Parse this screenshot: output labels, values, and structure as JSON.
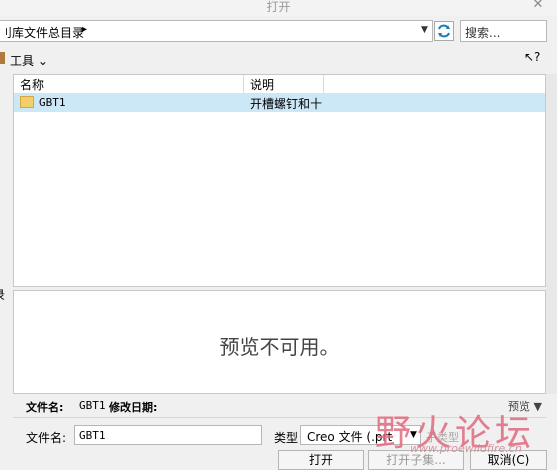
{
  "window": {
    "title": "打开",
    "close_glyph": "✕"
  },
  "address": {
    "path": "刂库文件总目录",
    "chevron": "▸",
    "dropdown": "▼"
  },
  "search": {
    "placeholder": "搜索..."
  },
  "toolbar": {
    "tools_label": "工具 ⌄",
    "help_glyph": "↖?"
  },
  "left_pane": {
    "clipped_char": "录"
  },
  "file_list": {
    "columns": [
      "名称",
      "说明"
    ],
    "rows": [
      {
        "name": "GBT1",
        "description": "开槽螺钉和十",
        "selected": true,
        "icon": "folder-icon"
      }
    ]
  },
  "preview": {
    "message": "预览不可用。",
    "toggle_label": "预览 ▼"
  },
  "info": {
    "filename_label": "文件名:",
    "filename_value": "GBT1",
    "modified_label": "修改日期:"
  },
  "form": {
    "filename_label": "文件名:",
    "filename_value": "GBT1",
    "type_label": "类型",
    "type_value": "Creo 文件 (.prt",
    "subtype_label": "子类型"
  },
  "buttons": {
    "open": "打开",
    "open_subset": "打开子集...",
    "cancel": "取消(C)"
  },
  "watermark": {
    "text": "野火论坛",
    "url": "www.proewildfire.cn"
  }
}
